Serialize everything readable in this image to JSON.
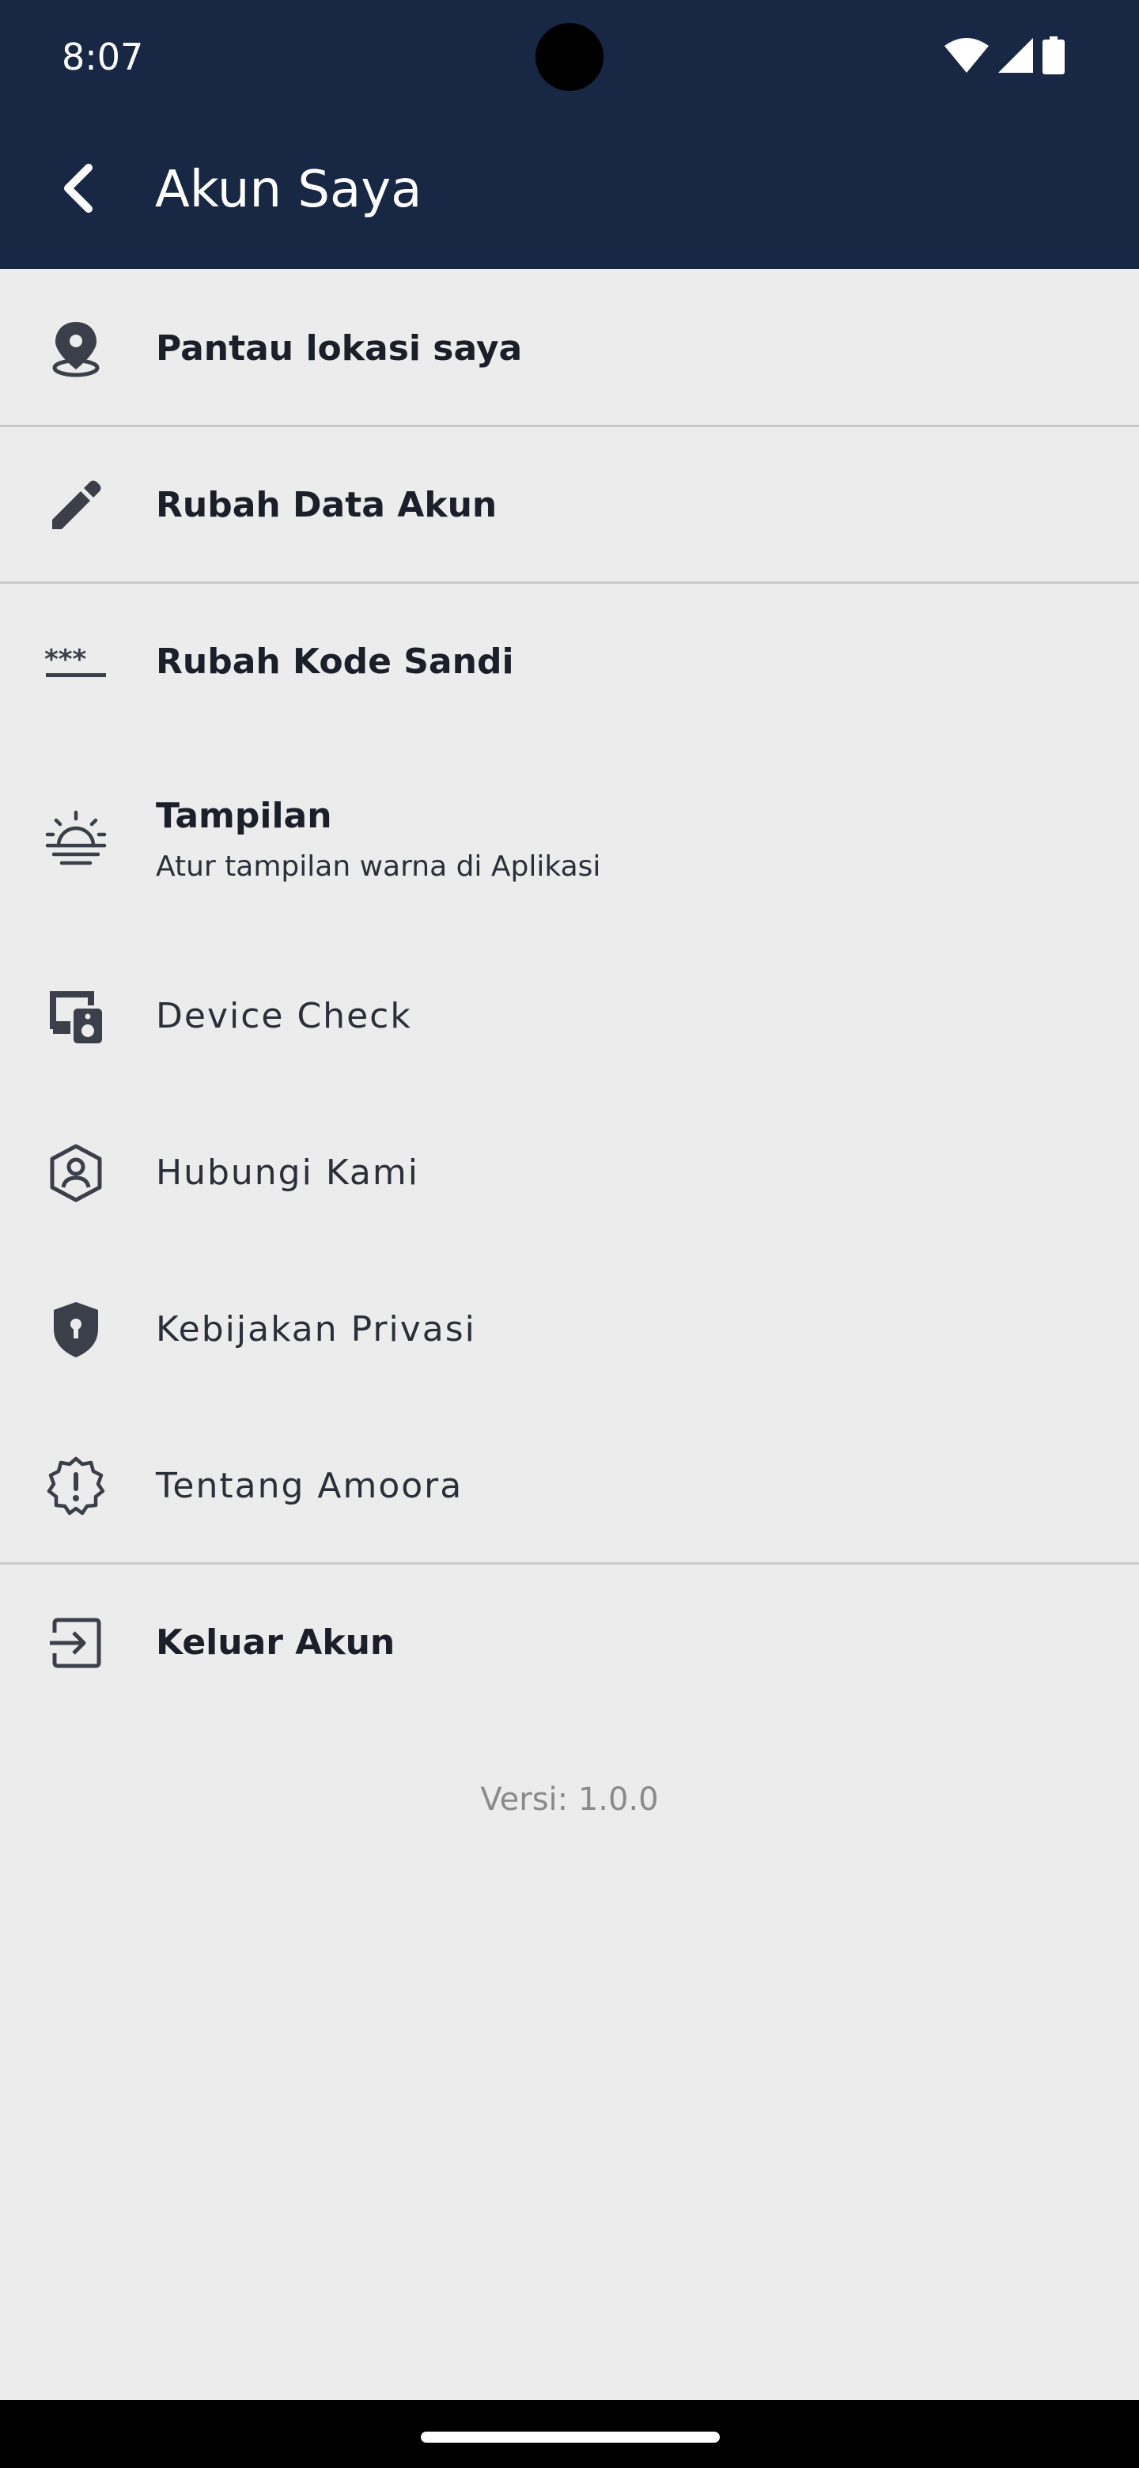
{
  "status_bar": {
    "time": "8:07",
    "icons": [
      "wifi-icon",
      "signal-icon",
      "battery-icon"
    ]
  },
  "toolbar": {
    "back_icon": "arrow-back-icon",
    "title": "Akun Saya"
  },
  "menu": {
    "items": [
      {
        "label": "Pantau lokasi saya",
        "icon": "location-pin-icon"
      },
      {
        "label": "Rubah Data Akun",
        "icon": "pencil-icon"
      },
      {
        "label": "Rubah Kode Sandi",
        "icon": "password-icon"
      },
      {
        "label": "Tampilan",
        "subtitle": "Atur tampilan warna di Aplikasi",
        "icon": "sunrise-icon"
      },
      {
        "label": "Device Check",
        "icon": "devices-icon"
      },
      {
        "label": "Hubungi Kami",
        "icon": "contact-shield-icon"
      },
      {
        "label": "Kebijakan Privasi",
        "icon": "privacy-shield-icon"
      },
      {
        "label": "Tentang Amoora",
        "icon": "info-badge-icon"
      },
      {
        "label": "Keluar Akun",
        "icon": "logout-icon"
      }
    ]
  },
  "footer": {
    "version": "Versi: 1.0.0"
  },
  "colors": {
    "header_bg": "#172744",
    "page_bg": "#ececec",
    "icon": "#3a3f4a",
    "text_primary": "#1b1f2a",
    "text_muted": "#8a8a8a",
    "divider": "#c9c9c9"
  }
}
